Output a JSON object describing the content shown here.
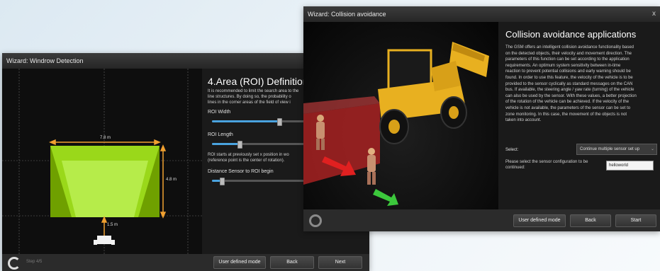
{
  "windroweditor": {
    "title": "Wizard: Windrow Detection",
    "heading": "4.Area (ROI) Definition",
    "intro": [
      "It is recommended to limit the search area to the",
      "line structures. By doing so, the probability o",
      "lines in the corner areas of the field of view i"
    ],
    "roi_width_label": "ROI Width",
    "roi_width_level": 0.68,
    "roi_length_label": "ROI Length",
    "roi_length_level": 0.28,
    "roi_note": [
      "ROI starts at previously set x position in wo",
      "(reference point is the center of rotation)."
    ],
    "distance_label": "Distance Sensor to ROI begin",
    "distance_level": 0.1,
    "dims": {
      "width": "7.8 m",
      "length": "4.8 m",
      "offset": "1.5 m"
    },
    "step": "Step 4/5",
    "buttons": {
      "user_defined": "User defined mode",
      "back": "Back",
      "next": "Next"
    },
    "colors": {
      "roi_fill": "#8fd400",
      "arrow": "#f0a030"
    }
  },
  "collision": {
    "title": "Wizard: Collision avoidance",
    "close": "x",
    "heading": "Collision avoidance applications",
    "paragraph": [
      "The GSM offers an intelligent collision avoidance functionality based",
      "on the detected objects, their velocity and movement direction. The",
      "parameters of this function can be set according to the application",
      "requirements. An optimum system sensitivity between in-time",
      "reaction to prevent potential collisions and early warning should be",
      "found. In order to use this feature, the velocity of the vehicle is to be",
      "provided to the sensor cyclically as standard messages on the CAN",
      "bus. If available, the steering angle / yaw rate (turning) of the vehicle",
      "can also be used by the sensor. With these values, a better projection",
      "of the rotation of the vehicle can be achieved. If the velocity of the",
      "vehicle is not available, the parameters of the sensor can be set to",
      "zone monitoring. In this case, the movement of the objects is not",
      "taken into account."
    ],
    "select_label": "Select:",
    "select_value": "Continue multiple sensor set up",
    "config_label": [
      "Please select the sensor configuration to be",
      "continued:"
    ],
    "config_value": "helloworld",
    "buttons": {
      "user_defined": "User defined mode",
      "back": "Back",
      "start": "Start"
    },
    "colors": {
      "vehicle": "#e8b020",
      "danger_zone": "#c83030",
      "danger_arrow": "#e02020",
      "safe_arrow": "#3cc83c"
    }
  }
}
